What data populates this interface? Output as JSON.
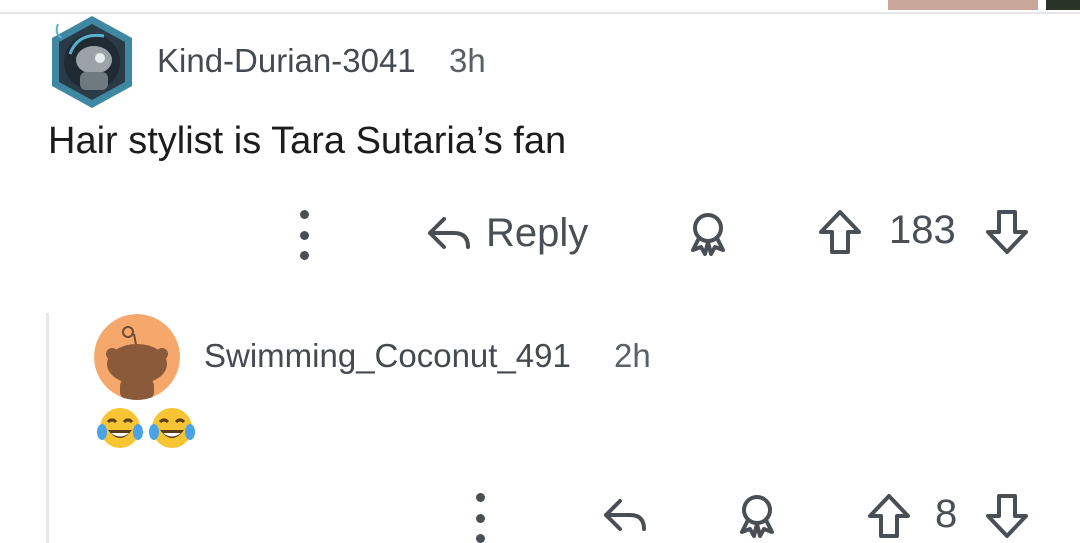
{
  "comments": [
    {
      "username": "Kind-Durian-3041",
      "timestamp": "3h",
      "body": "Hair stylist is Tara Sutaria’s fan",
      "actions": {
        "more_icon": "more-vertical-icon",
        "reply_label": "Reply",
        "award_icon": "award-icon",
        "upvote_icon": "upvote-arrow-icon",
        "score": "183",
        "downvote_icon": "downvote-arrow-icon"
      }
    },
    {
      "username": "Swimming_Coconut_491",
      "timestamp": "2h",
      "body": "😂😂",
      "actions": {
        "more_icon": "more-vertical-icon",
        "reply_icon": "reply-arrow-icon",
        "award_icon": "award-icon",
        "upvote_icon": "upvote-arrow-icon",
        "score": "8",
        "downvote_icon": "downvote-arrow-icon"
      }
    }
  ],
  "colors": {
    "text_primary": "#1c1c1c",
    "text_meta": "#454a50",
    "icon_gray": "#4a4f55",
    "divider": "#e4e6e8",
    "avatar2_bg": "#f6a86c",
    "avatar1_bg": "#3f88a3"
  }
}
